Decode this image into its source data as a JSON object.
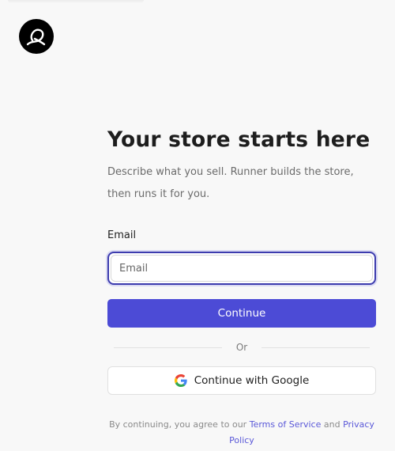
{
  "header": {
    "logo_icon": "runner-logo-icon"
  },
  "main": {
    "title": "Your store starts here",
    "subtitle": "Describe what you sell. Runner builds the store, then runs it for you.",
    "email_label": "Email",
    "email_placeholder": "Email",
    "email_value": "",
    "continue_label": "Continue",
    "divider_text": "Or",
    "google_label": "Continue with Google",
    "google_icon": "google-icon"
  },
  "footer": {
    "terms_prefix": "By continuing, you agree to our",
    "terms_link": "Terms of Service",
    "terms_and": "and",
    "privacy_link": "Privacy Policy"
  },
  "colors": {
    "accent": "#4c4bd6",
    "focus_border": "#3d3cae",
    "link": "#5a58d8",
    "background": "#f8f8f8"
  }
}
